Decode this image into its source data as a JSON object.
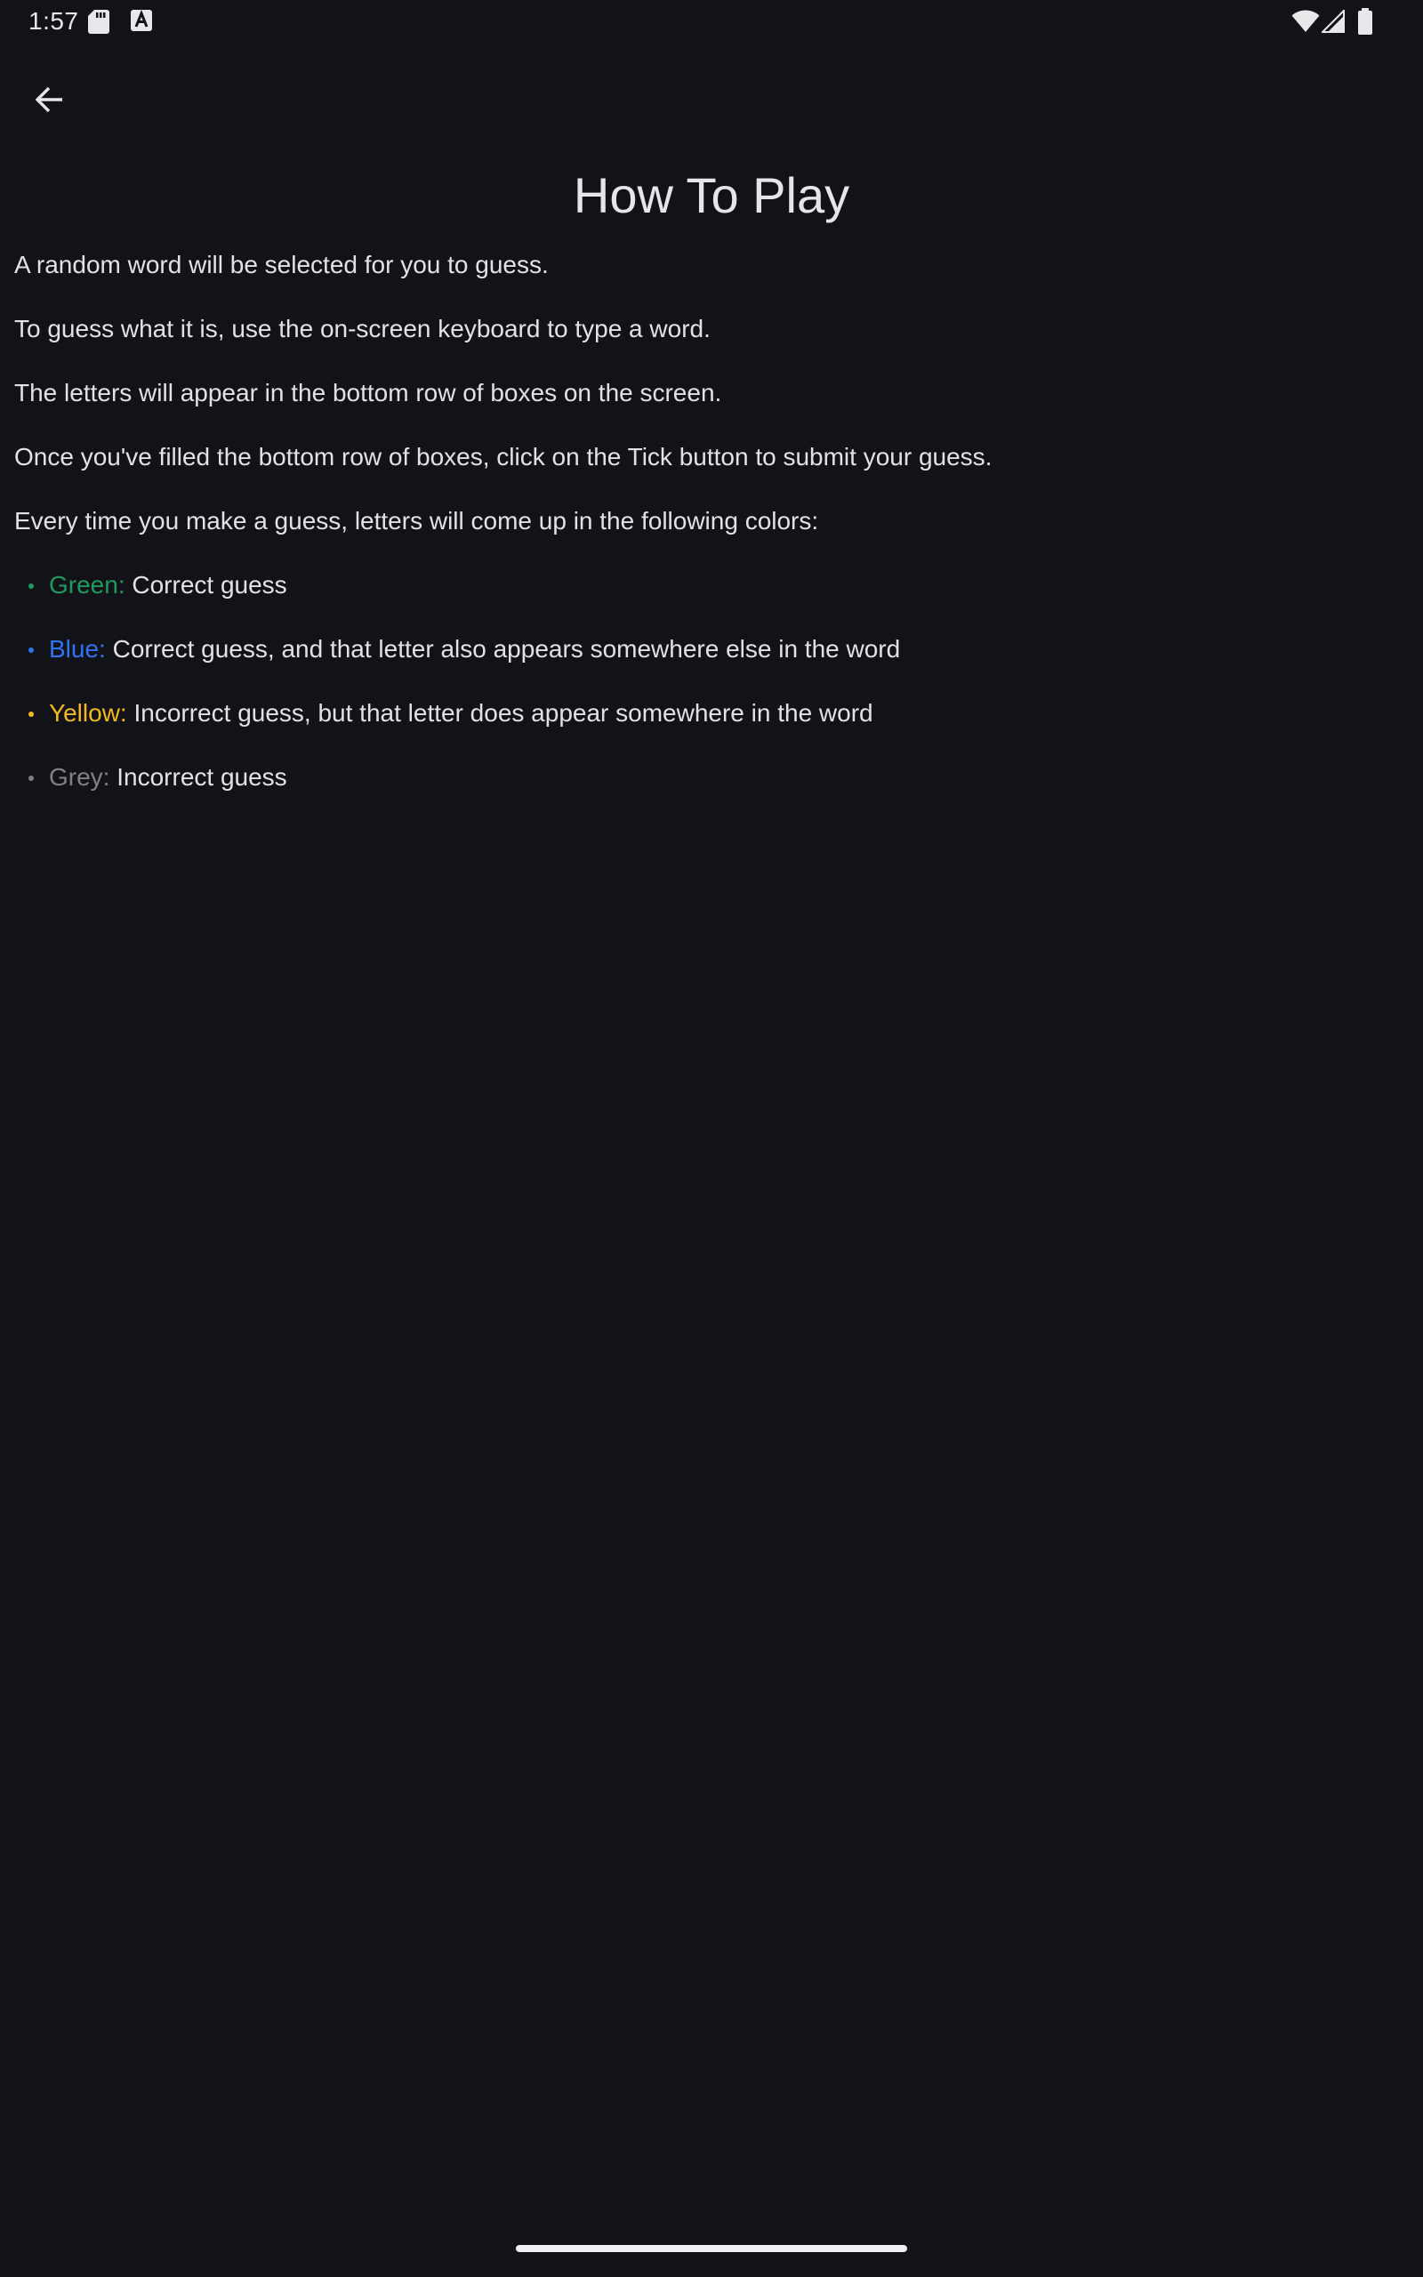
{
  "status_bar": {
    "time": "1:57",
    "icons": [
      "sd-card-icon",
      "a-notification-icon",
      "wifi-icon",
      "signal-icon",
      "battery-icon"
    ]
  },
  "app_bar": {
    "back_icon": "arrow-back-icon"
  },
  "title": "How To Play",
  "paragraphs": [
    "A random word will be selected for you to guess.",
    "To guess what it is, use the on-screen keyboard to type a word.",
    "The letters will appear in the bottom row of boxes on the screen.",
    "Once you've filled the bottom row of boxes, click on the Tick button to submit your guess.",
    "Every time you make a guess, letters will come up in the following colors:"
  ],
  "color_legend": [
    {
      "label": "Green:",
      "description": "Correct guess",
      "color": "#1d9a5f"
    },
    {
      "label": "Blue:",
      "description": "Correct guess, and that letter also appears somewhere else in the word",
      "color": "#2f74f2"
    },
    {
      "label": "Yellow:",
      "description": "Incorrect guess, but that letter does appear somewhere in the word",
      "color": "#f2b81c"
    },
    {
      "label": "Grey:",
      "description": "Incorrect guess",
      "color": "#7f8187"
    }
  ],
  "theme": {
    "background": "#121319",
    "text": "#e2e2e5"
  }
}
